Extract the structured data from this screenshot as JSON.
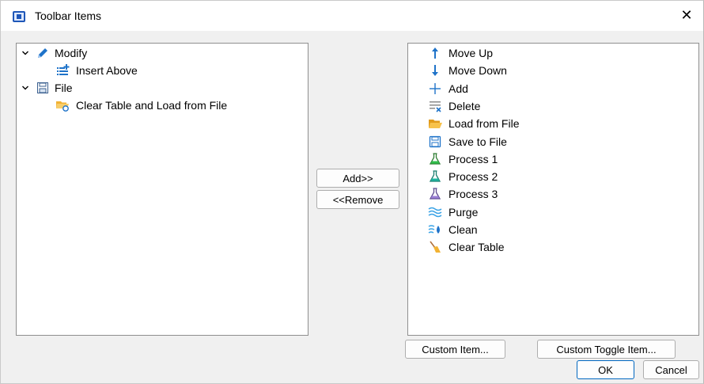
{
  "window": {
    "title": "Toolbar Items",
    "close_glyph": "✕"
  },
  "left_tree": [
    {
      "label": "Modify",
      "icon": "pencil-icon",
      "expanded": true,
      "children": [
        {
          "label": "Insert Above",
          "icon": "insert-above-icon"
        }
      ]
    },
    {
      "label": "File",
      "icon": "file-icon",
      "expanded": true,
      "children": [
        {
          "label": "Clear Table and Load from File",
          "icon": "folder-reload-icon"
        }
      ]
    }
  ],
  "middle": {
    "add_label": "Add>>",
    "remove_label": "<<Remove"
  },
  "right_list": [
    {
      "label": "Move Up",
      "icon": "arrow-up-icon"
    },
    {
      "label": "Move Down",
      "icon": "arrow-down-icon"
    },
    {
      "label": "Add",
      "icon": "plus-icon"
    },
    {
      "label": "Delete",
      "icon": "delete-list-icon"
    },
    {
      "label": "Load from File",
      "icon": "folder-open-icon"
    },
    {
      "label": "Save to File",
      "icon": "save-icon"
    },
    {
      "label": "Process 1",
      "icon": "flask-green-icon"
    },
    {
      "label": "Process 2",
      "icon": "flask-teal-icon"
    },
    {
      "label": "Process 3",
      "icon": "flask-purple-icon"
    },
    {
      "label": "Purge",
      "icon": "waves-icon"
    },
    {
      "label": "Clean",
      "icon": "clean-icon"
    },
    {
      "label": "Clear Table",
      "icon": "broom-icon"
    }
  ],
  "buttons": {
    "custom_item": "Custom Item...",
    "custom_toggle_item": "Custom Toggle Item...",
    "ok": "OK",
    "cancel": "Cancel"
  },
  "colors": {
    "accent": "#0067c0",
    "folder": "#f2b233",
    "icon_blue": "#1f73c9"
  }
}
